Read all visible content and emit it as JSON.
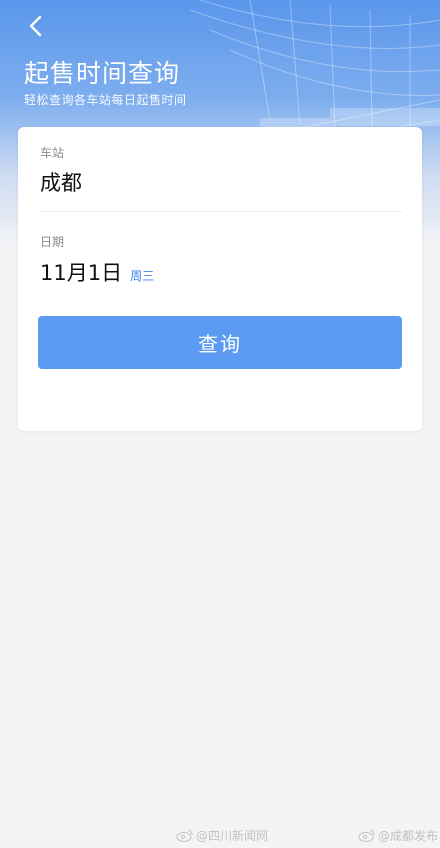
{
  "header": {
    "title": "起售时间查询",
    "subtitle": "轻松查询各车站每日起售时间",
    "back_icon": "chevron-left-icon"
  },
  "form": {
    "station_label": "车站",
    "station_value": "成都",
    "date_label": "日期",
    "date_value": "11月1日",
    "weekday": "周三",
    "query_label": "查询"
  },
  "colors": {
    "accent": "#5b9bf3",
    "weekday": "#3c82ec",
    "header": "#5a96eb"
  },
  "watermarks": [
    {
      "text": "@四川新闻网",
      "icon": "weibo-icon"
    },
    {
      "text": "@成都发布",
      "icon": "weibo-icon"
    }
  ]
}
